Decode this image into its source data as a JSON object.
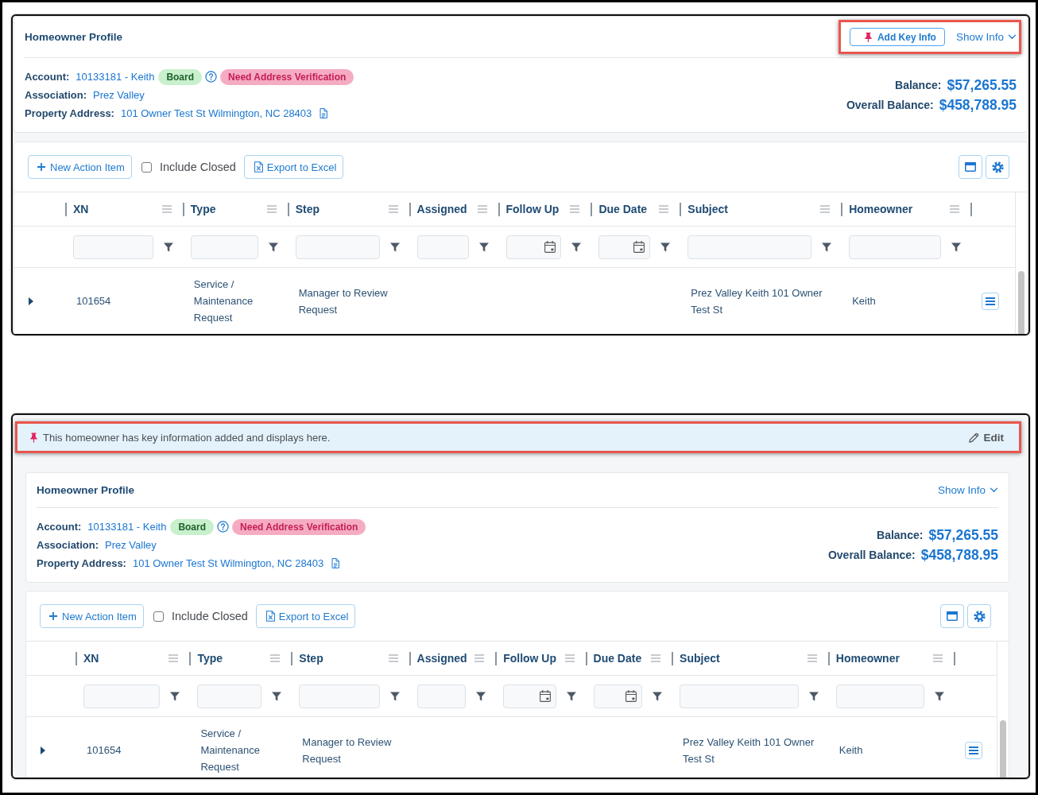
{
  "screenshots": [
    {
      "profile": {
        "title": "Homeowner Profile",
        "header_actions": {
          "highlighted": true,
          "add_key_info": "Add Key Info",
          "show_info": "Show Info"
        },
        "account": {
          "label": "Account:",
          "value": "10133181 - Keith"
        },
        "tags": [
          {
            "label": "Board",
            "kind": "role"
          },
          {
            "label": "Need Address Verification",
            "kind": "alert"
          }
        ],
        "association": {
          "label": "Association:",
          "value": "Prez Valley"
        },
        "property_address": {
          "label": "Property Address:",
          "value": "101 Owner Test St Wilmington, NC 28403"
        },
        "balance": {
          "label": "Balance:",
          "value": "$57,265.55"
        },
        "overall_balance": {
          "label": "Overall Balance:",
          "value": "$458,788.95"
        }
      },
      "toolbar": {
        "new_action_item": "New Action Item",
        "include_closed": {
          "label": "Include Closed",
          "checked": false
        },
        "export_to_excel": "Export to Excel"
      },
      "table": {
        "columns": [
          {
            "label": "XN",
            "kind": "text"
          },
          {
            "label": "Type",
            "kind": "text"
          },
          {
            "label": "Step",
            "kind": "text"
          },
          {
            "label": "Assigned",
            "kind": "text"
          },
          {
            "label": "Follow Up",
            "kind": "date"
          },
          {
            "label": "Due Date",
            "kind": "date"
          },
          {
            "label": "Subject",
            "kind": "text"
          },
          {
            "label": "Homeowner",
            "kind": "text"
          }
        ],
        "rows": [
          {
            "expanded": false,
            "xn": "101654",
            "type": "Service / Maintenance Request",
            "step": "Manager to Review Request",
            "subject": "Prez Valley Keith 101 Owner Test St",
            "homeowner": "Keith"
          }
        ]
      }
    },
    {
      "key_info_banner": {
        "highlighted": true,
        "text": "This homeowner has key information added and displays here.",
        "edit": "Edit"
      },
      "profile": {
        "title": "Homeowner Profile",
        "header_actions": {
          "show_info": "Show Info"
        },
        "account": {
          "label": "Account:",
          "value": "10133181 - Keith"
        },
        "tags": [
          {
            "label": "Board",
            "kind": "role"
          },
          {
            "label": "Need Address Verification",
            "kind": "alert"
          }
        ],
        "association": {
          "label": "Association:",
          "value": "Prez Valley"
        },
        "property_address": {
          "label": "Property Address:",
          "value": "101 Owner Test St Wilmington, NC 28403"
        },
        "balance": {
          "label": "Balance:",
          "value": "$57,265.55"
        },
        "overall_balance": {
          "label": "Overall Balance:",
          "value": "$458,788.95"
        }
      },
      "toolbar": {
        "new_action_item": "New Action Item",
        "include_closed": {
          "label": "Include Closed",
          "checked": false
        },
        "export_to_excel": "Export to Excel"
      },
      "table": {
        "columns": [
          {
            "label": "XN",
            "kind": "text"
          },
          {
            "label": "Type",
            "kind": "text"
          },
          {
            "label": "Step",
            "kind": "text"
          },
          {
            "label": "Assigned",
            "kind": "text"
          },
          {
            "label": "Follow Up",
            "kind": "date"
          },
          {
            "label": "Due Date",
            "kind": "date"
          },
          {
            "label": "Subject",
            "kind": "text"
          },
          {
            "label": "Homeowner",
            "kind": "text"
          }
        ],
        "rows": [
          {
            "expanded": false,
            "xn": "101654",
            "type": "Service / Maintenance Request",
            "step": "Manager to Review Request",
            "subject": "Prez Valley Keith 101 Owner Test St",
            "homeowner": "Keith"
          }
        ]
      }
    }
  ]
}
